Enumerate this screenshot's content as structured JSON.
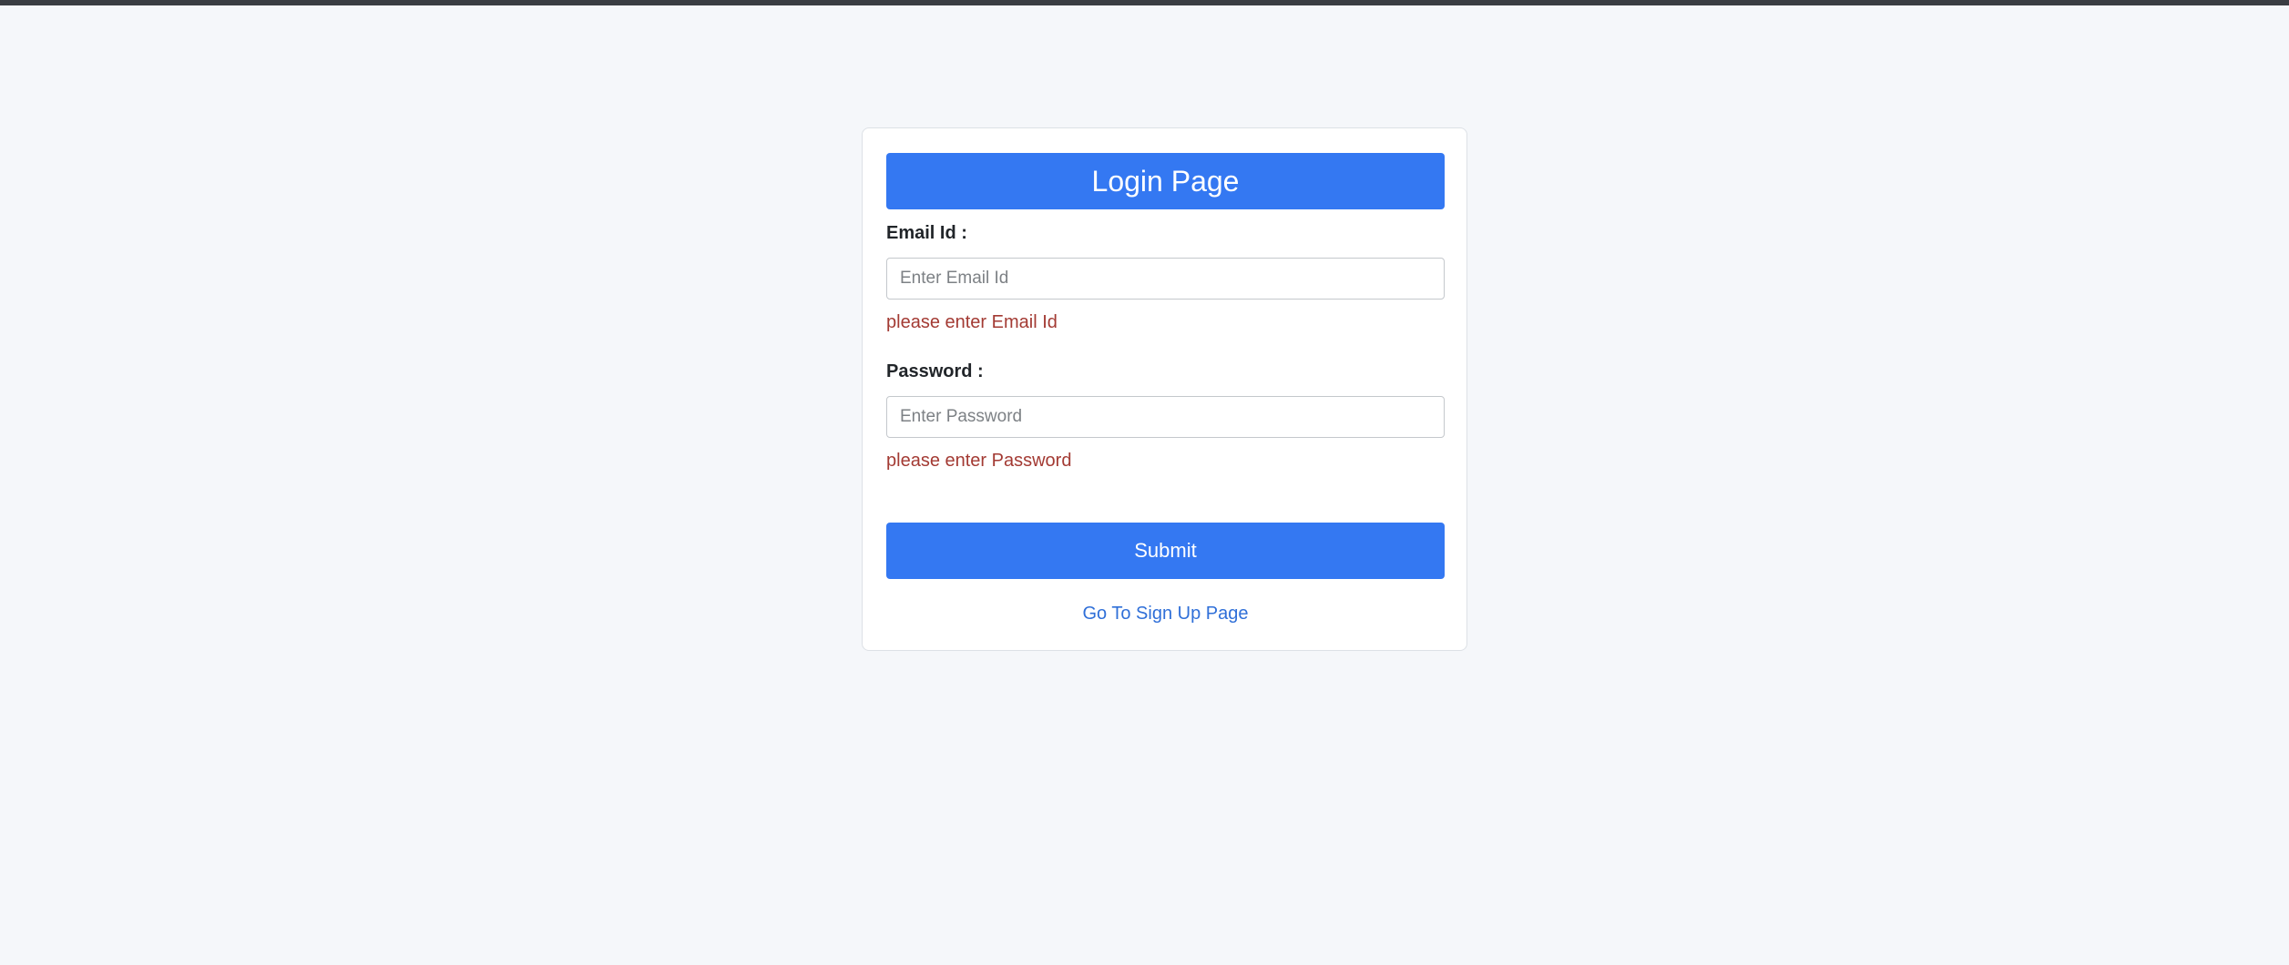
{
  "form": {
    "title": "Login Page",
    "email_label": "Email Id :",
    "email_placeholder": "Enter Email Id",
    "email_error": "please enter Email Id",
    "password_label": "Password :",
    "password_placeholder": "Enter Password",
    "password_error": "please enter Password",
    "submit_label": "Submit",
    "signup_link": "Go To Sign Up Page"
  },
  "colors": {
    "accent": "#3478f2",
    "error": "#a33a33",
    "link": "#2f6fd8",
    "background": "#f5f7fa"
  }
}
